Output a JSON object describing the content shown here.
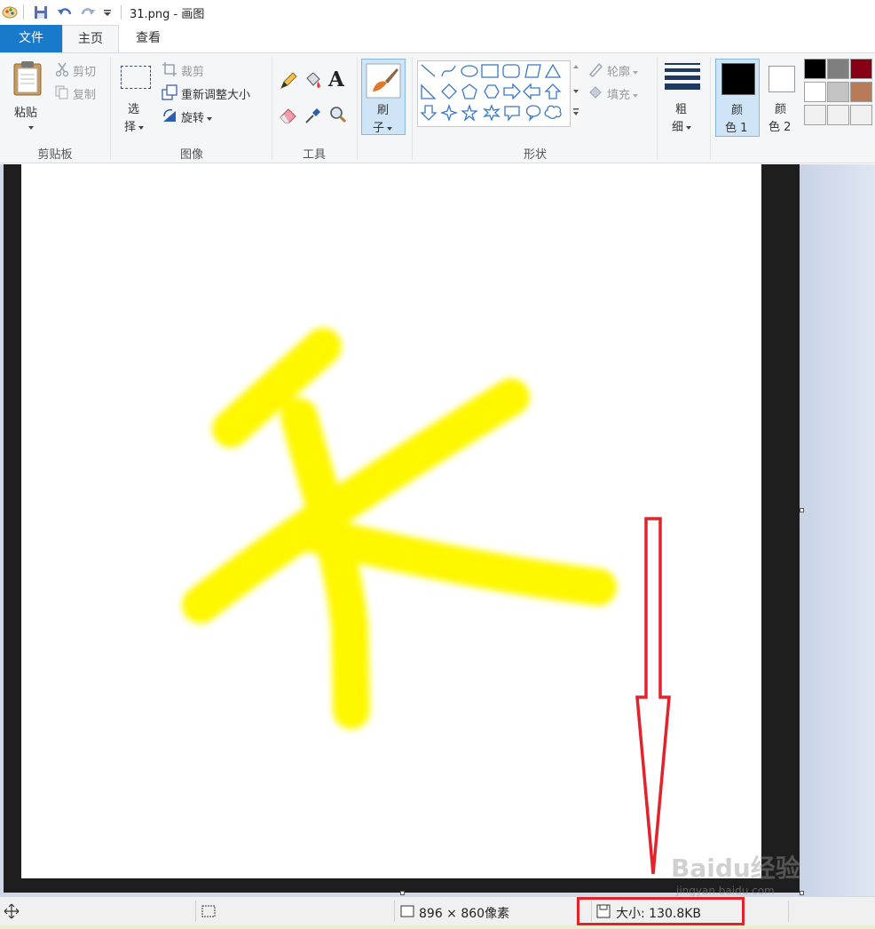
{
  "window": {
    "title": "31.png - 画图"
  },
  "tabs": [
    {
      "label": "文件"
    },
    {
      "label": "主页"
    },
    {
      "label": "查看"
    }
  ],
  "ribbon": {
    "clipboard": {
      "paste": "粘贴",
      "cut": "剪切",
      "copy": "复制",
      "group_label": "剪贴板"
    },
    "image": {
      "select_line1": "选",
      "select_line2": "择",
      "crop": "裁剪",
      "resize": "重新调整大小",
      "rotate": "旋转",
      "group_label": "图像"
    },
    "tools": {
      "text_glyph": "A",
      "group_label": "工具"
    },
    "brushes": {
      "line1": "刷",
      "line2": "子"
    },
    "shapes": {
      "outline": "轮廓",
      "fill": "填充",
      "group_label": "形状"
    },
    "size": {
      "line1": "粗",
      "line2": "细"
    },
    "color1": {
      "line1": "颜",
      "line2": "色 1",
      "value": "#000000"
    },
    "color2": {
      "line1": "颜",
      "line2": "色 2",
      "value": "#ffffff"
    },
    "palette": [
      "#000000",
      "#7f7f7f",
      "#880015",
      "#ffffff",
      "#c3c3c3",
      "#b97a57",
      "#f0f0f0",
      "#f0f0f0",
      "#f0f0f0"
    ]
  },
  "canvas": {
    "stroke_color": "#fff700"
  },
  "statusbar": {
    "dimensions": "896 × 860像素",
    "size": "大小: 130.8KB"
  },
  "annotation": {
    "color": "#e3232b"
  },
  "watermark": {
    "brand": "Baidu经验",
    "url": "jingyan.baidu.com"
  }
}
